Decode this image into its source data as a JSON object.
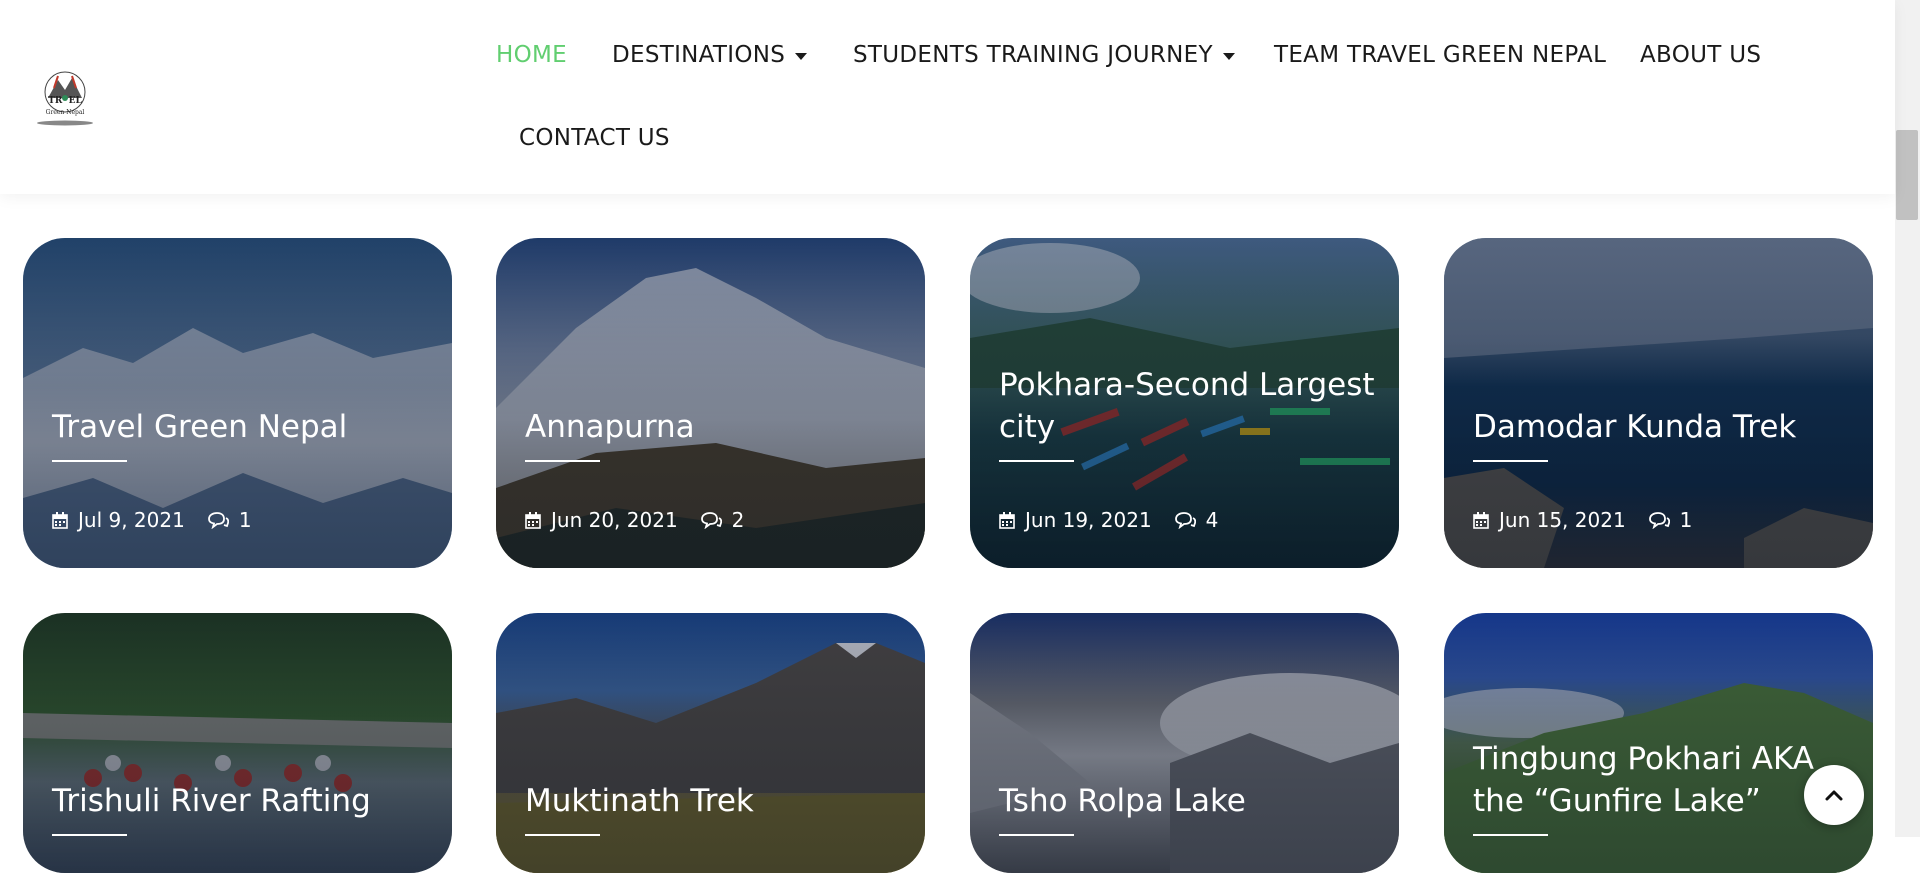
{
  "nav": {
    "items": [
      {
        "label": "HOME"
      },
      {
        "label": "DESTINATIONS"
      },
      {
        "label": "STUDENTS TRAINING JOURNEY"
      },
      {
        "label": "TEAM TRAVEL GREEN NEPAL"
      },
      {
        "label": "ABOUT US"
      },
      {
        "label": "CONTACT US"
      }
    ],
    "active_color": "#61ce70"
  },
  "logo": {
    "text_top": "TRAVEL",
    "text_bottom": "Green Nepal"
  },
  "posts": [
    {
      "title": "Travel Green Nepal",
      "date": "Jul 9, 2021",
      "comments": "1"
    },
    {
      "title": "Annapurna",
      "date": "Jun 20, 2021",
      "comments": "2"
    },
    {
      "title": "Pokhara-Second Largest city",
      "date": "Jun 19, 2021",
      "comments": "4"
    },
    {
      "title": "Damodar Kunda Trek",
      "date": "Jun 15, 2021",
      "comments": "1"
    },
    {
      "title": "Trishuli River Rafting"
    },
    {
      "title": "Muktinath Trek"
    },
    {
      "title": "Tsho Rolpa Lake"
    },
    {
      "title": "Tingbung Pokhari AKA the “Gunfire Lake”"
    }
  ],
  "icons": {
    "calendar": "calendar-icon",
    "comment": "comment-icon",
    "back_to_top": "chevron-up-icon",
    "dropdown": "caret-down-icon"
  }
}
